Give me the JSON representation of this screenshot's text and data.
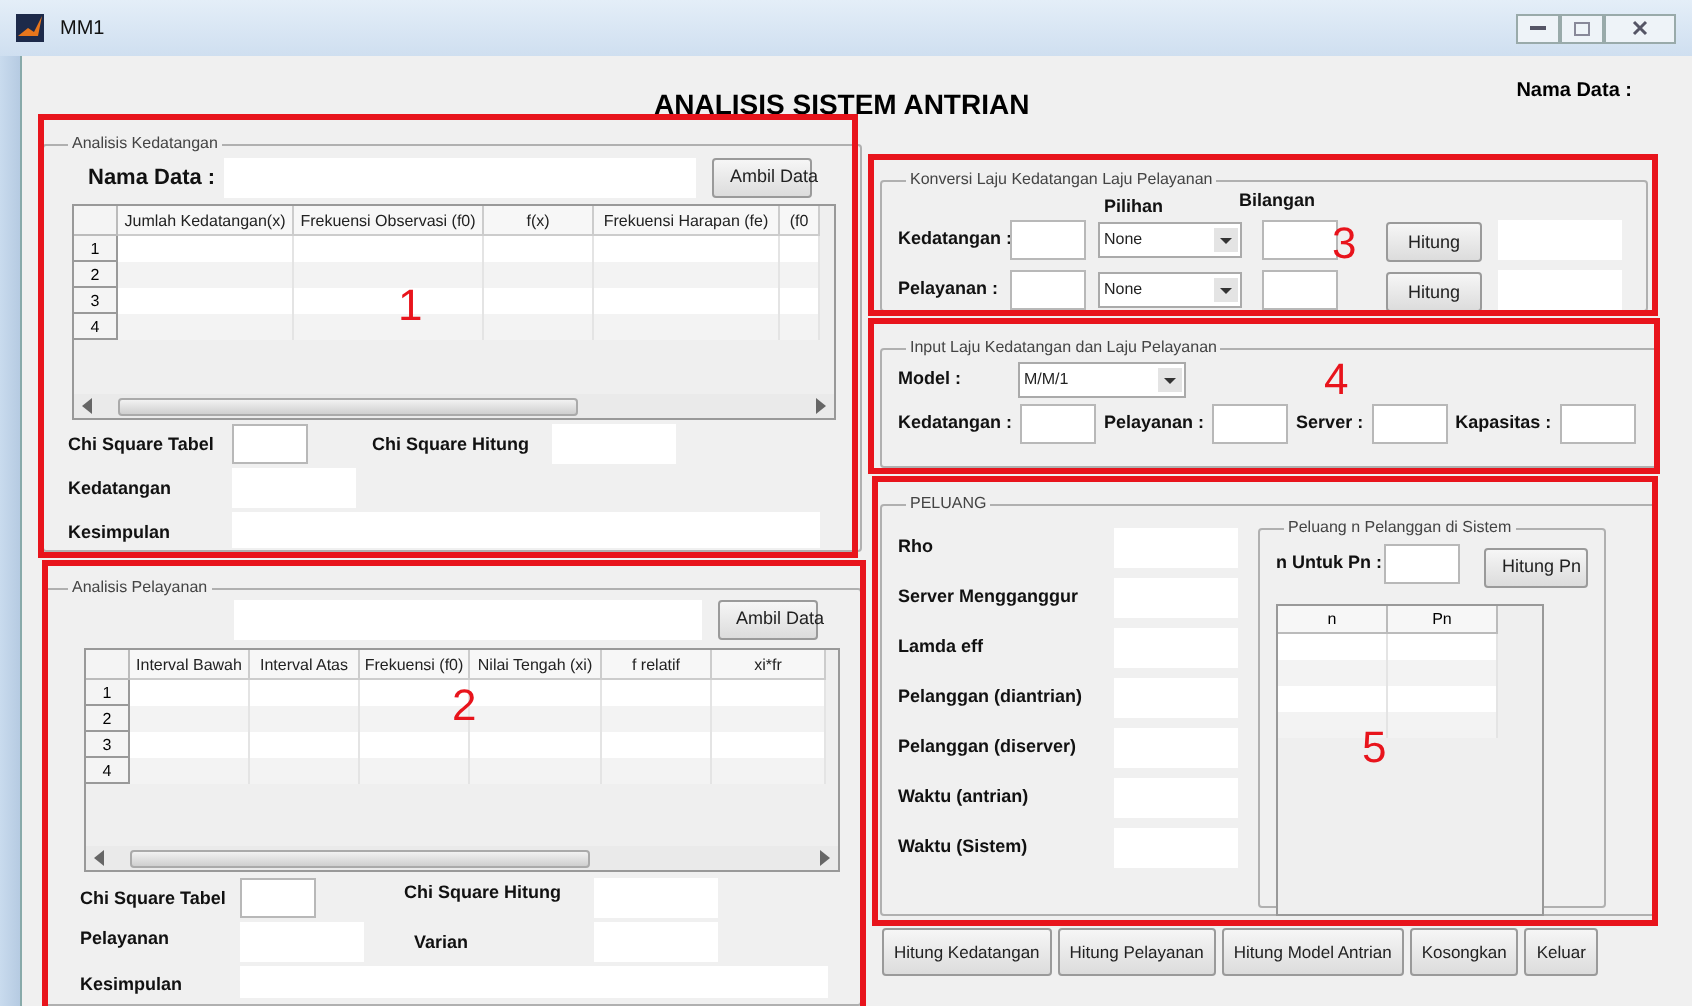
{
  "window": {
    "title": "MM1"
  },
  "header": {
    "title": "ANALISIS SISTEM ANTRIAN",
    "nama_data_label": "Nama Data :"
  },
  "kedatangan_panel": {
    "title": "Analisis Kedatangan",
    "nama_data_label": "Nama Data :",
    "button": "Ambil Data",
    "table": {
      "columns": [
        "Jumlah Kedatangan(x)",
        "Frekuensi Observasi (f0)",
        "f(x)",
        "Frekuensi  Harapan (fe)",
        "(f0"
      ],
      "rows": [
        "1",
        "2",
        "3",
        "4"
      ]
    },
    "chi_square_tabel_label": "Chi Square Tabel",
    "chi_square_hitung_label": "Chi Square Hitung",
    "rate_label": "Kedatangan",
    "kesimpulan_label": "Kesimpulan"
  },
  "pelayanan_panel": {
    "title": "Analisis Pelayanan",
    "button": "Ambil Data",
    "table": {
      "columns": [
        "Interval Bawah",
        "Interval Atas",
        "Frekuensi (f0)",
        "Nilai Tengah (xi)",
        "f relatif",
        "xi*fr"
      ],
      "rows": [
        "1",
        "2",
        "3",
        "4"
      ]
    },
    "chi_square_tabel_label": "Chi Square Tabel",
    "chi_square_hitung_label": "Chi Square Hitung",
    "rate_label": "Pelayanan",
    "varian_label": "Varian",
    "kesimpulan_label": "Kesimpulan"
  },
  "konversi_panel": {
    "title": "Konversi Laju Kedatangan Laju Pelayanan",
    "pilihan_label": "Pilihan",
    "bilangan_label": "Bilangan",
    "rows": [
      {
        "label": "Kedatangan :",
        "choice": "None",
        "button": "Hitung"
      },
      {
        "label": "Pelayanan :",
        "choice": "None",
        "button": "Hitung"
      }
    ]
  },
  "input_panel": {
    "title": "Input Laju Kedatangan dan Laju Pelayanan",
    "model_label": "Model :",
    "model": "M/M/1",
    "fields": [
      "Kedatangan :",
      "Pelayanan :",
      "Server :",
      "Kapasitas :"
    ]
  },
  "peluang_panel": {
    "title": "PELUANG",
    "rows": [
      "Rho",
      "Server Mengganggur",
      "Lamda eff",
      "Pelanggan (diantrian)",
      "Pelanggan (diserver)",
      "Waktu (antrian)",
      "Waktu (Sistem)"
    ],
    "pn_panel": {
      "title": "Peluang n Pelanggan di Sistem",
      "n_label": "n Untuk Pn :",
      "button": "Hitung Pn",
      "columns": [
        "n",
        "Pn"
      ]
    }
  },
  "buttons": [
    "Hitung Kedatangan",
    "Hitung Pelayanan",
    "Hitung Model Antrian",
    "Kosongkan",
    "Keluar"
  ],
  "annotations": [
    {
      "label": "1"
    },
    {
      "label": "2"
    },
    {
      "label": "3"
    },
    {
      "label": "4"
    },
    {
      "label": "5"
    }
  ]
}
